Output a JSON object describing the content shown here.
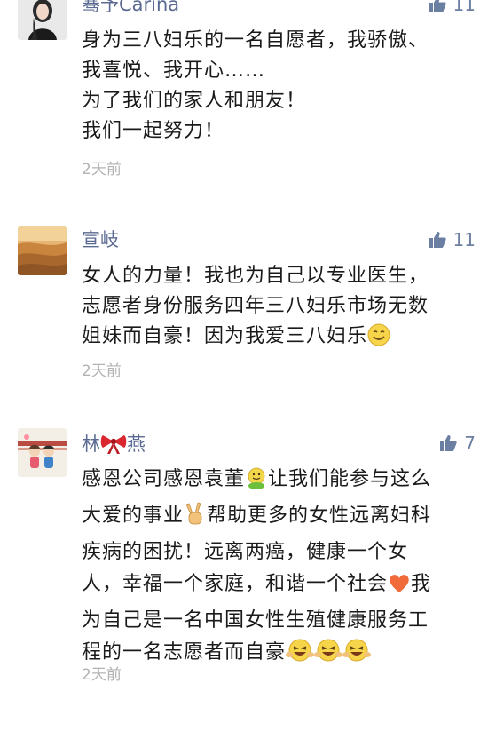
{
  "comments": [
    {
      "name": "骞予Carina",
      "likes": "11",
      "lines": [
        "身为三八妇乐的一名自愿者，我骄傲、",
        "我喜悦、我开心……",
        "为了我们的家人和朋友！",
        "我们一起努力！"
      ],
      "time": "2天前",
      "avatar_icon": "woman-portrait-icon"
    },
    {
      "name": "宣岐",
      "likes": "11",
      "lines": [
        "女人的力量！我也为自己以专业医生，",
        "志愿者身份服务四年三八妇乐市场无数",
        "姐妹而自豪！因为我爱三八妇乐"
      ],
      "time": "2天前",
      "avatar_icon": "desert-dunes-icon"
    },
    {
      "name_parts": [
        "林",
        "燕"
      ],
      "likes": "7",
      "lines": [
        {
          "parts": [
            "感恩公司感恩袁董",
            "让我们能参与这么"
          ]
        },
        {
          "parts": [
            "大爱的事业",
            "帮助更多的女性远离妇科"
          ]
        },
        {
          "parts": [
            "疾病的困扰！远离两癌，健康一个女"
          ]
        },
        {
          "parts": [
            "人，幸福一个家庭，和谐一个社会",
            "我"
          ]
        },
        {
          "parts": [
            "为自己是一名中国女性生殖健康服务工"
          ]
        },
        {
          "parts": [
            "程的一名志愿者而自豪"
          ]
        }
      ],
      "time": "2天前",
      "avatar_icon": "cartoon-couple-icon"
    }
  ],
  "colors": {
    "name": "#5b6a92",
    "like": "#6b7fa3",
    "body": "#1a1a1a",
    "time": "#b3b3b3"
  }
}
